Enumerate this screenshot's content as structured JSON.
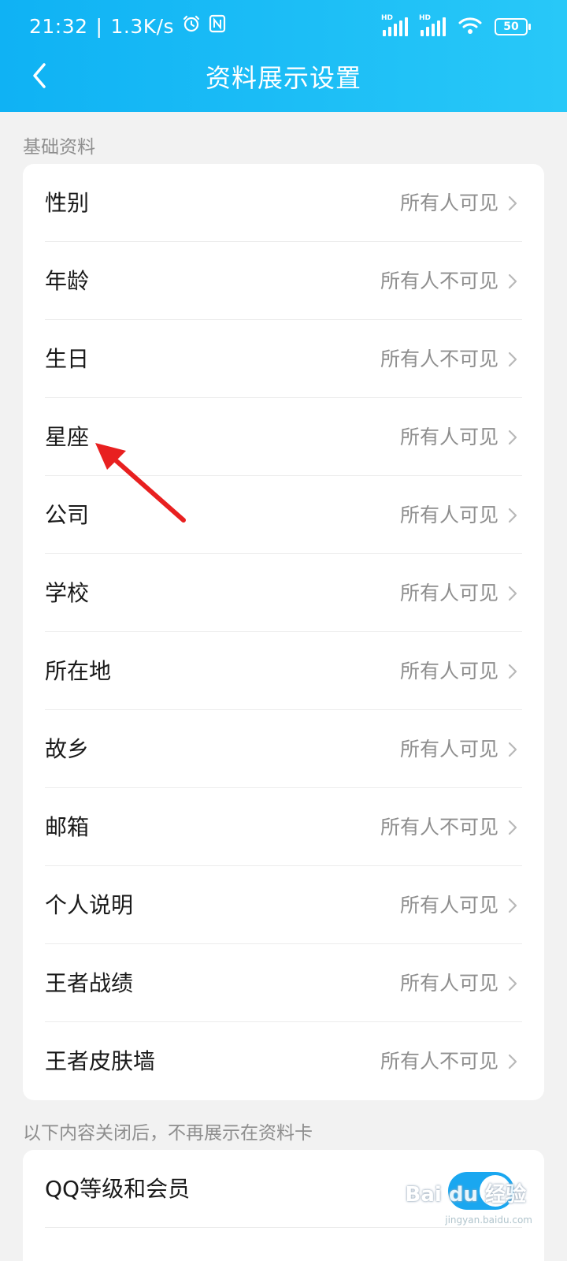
{
  "status_bar": {
    "time": "21:32",
    "separator": "|",
    "net_speed": "1.3K/s",
    "signal_badge": "HD",
    "battery": "50"
  },
  "nav": {
    "title": "资料展示设置",
    "back_icon": "chevron-left-icon"
  },
  "basic_section": {
    "label": "基础资料",
    "items": [
      {
        "label": "性别",
        "value": "所有人可见"
      },
      {
        "label": "年龄",
        "value": "所有人不可见"
      },
      {
        "label": "生日",
        "value": "所有人不可见"
      },
      {
        "label": "星座",
        "value": "所有人可见"
      },
      {
        "label": "公司",
        "value": "所有人可见"
      },
      {
        "label": "学校",
        "value": "所有人可见"
      },
      {
        "label": "所在地",
        "value": "所有人可见"
      },
      {
        "label": "故乡",
        "value": "所有人可见"
      },
      {
        "label": "邮箱",
        "value": "所有人不可见"
      },
      {
        "label": "个人说明",
        "value": "所有人可见"
      },
      {
        "label": "王者战绩",
        "value": "所有人可见"
      },
      {
        "label": "王者皮肤墙",
        "value": "所有人不可见"
      }
    ]
  },
  "card_section": {
    "label": "以下内容关闭后，不再展示在资料卡",
    "items": [
      {
        "label": "QQ等级和会员",
        "enabled": true
      }
    ]
  },
  "annotation": {
    "color": "#e82020",
    "icon": "arrow-annotation"
  },
  "watermark": {
    "brand": "Bai du 经验",
    "url": "jingyan.baidu.com"
  },
  "colors": {
    "header": "#19b8f6",
    "toggle_on": "#1aa7f0"
  }
}
